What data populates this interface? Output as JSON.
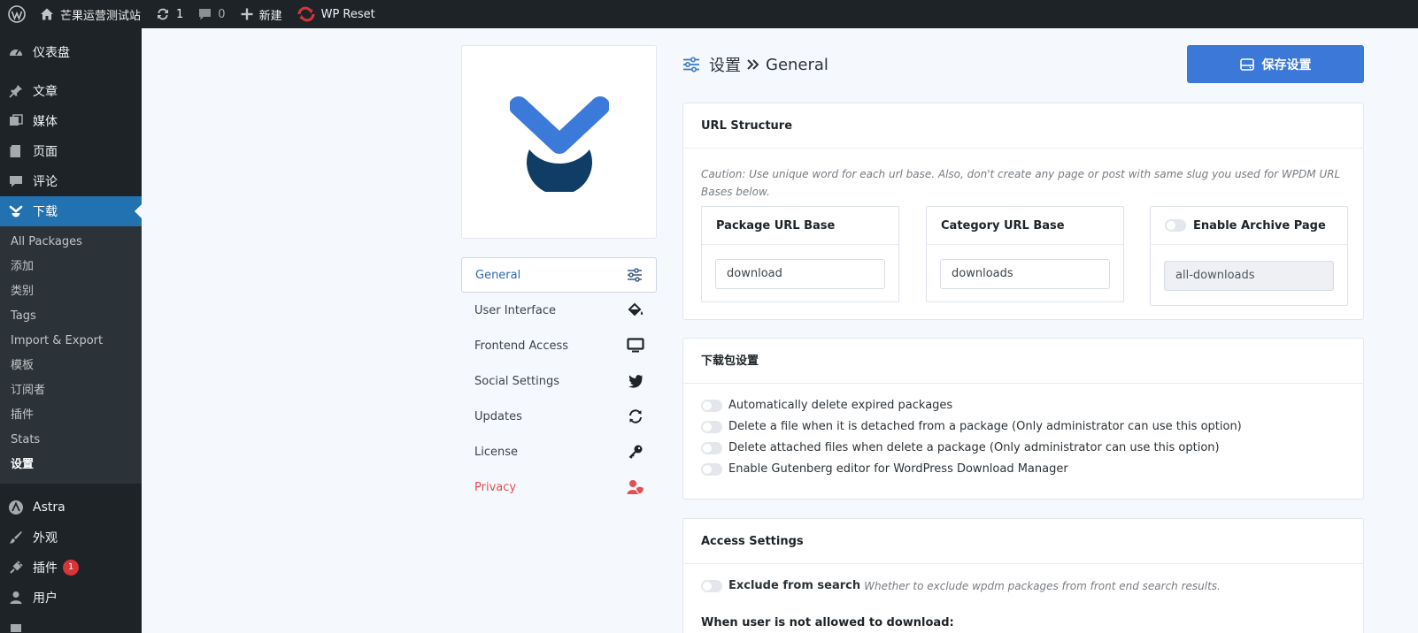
{
  "adminbar": {
    "site_name": "芒果运营测试站",
    "updates_count": "1",
    "comments_count": "0",
    "new_label": "新建",
    "plugin_label": "WP Reset"
  },
  "adminmenu": {
    "dashboard": "仪表盘",
    "posts": "文章",
    "media": "媒体",
    "pages": "页面",
    "comments": "评论",
    "downloads": "下载",
    "downloads_submenu": [
      "All Packages",
      "添加",
      "类别",
      "Tags",
      "Import & Export",
      "模板",
      "订阅者",
      "插件",
      "Stats",
      "设置"
    ],
    "astra": "Astra",
    "appearance": "外观",
    "plugins": "插件",
    "plugins_badge": "1",
    "users": "用户"
  },
  "settings_nav": [
    {
      "label": "General",
      "icon": "sliders-icon"
    },
    {
      "label": "User Interface",
      "icon": "paint-bucket-icon"
    },
    {
      "label": "Frontend Access",
      "icon": "monitor-icon"
    },
    {
      "label": "Social Settings",
      "icon": "twitter-icon"
    },
    {
      "label": "Updates",
      "icon": "refresh-icon"
    },
    {
      "label": "License",
      "icon": "key-icon"
    },
    {
      "label": "Privacy",
      "icon": "user-shield-icon"
    }
  ],
  "header": {
    "title_prefix": "设置",
    "title_section": "General",
    "save_label": "保存设置"
  },
  "url_structure": {
    "title": "URL Structure",
    "caution": "Caution: Use unique word for each url base. Also, don't create any page or post with same slug you used for WPDM URL Bases below.",
    "package_base_label": "Package URL Base",
    "package_base_value": "download",
    "category_base_label": "Category URL Base",
    "category_base_value": "downloads",
    "archive_label": "Enable Archive Page",
    "archive_value": "all-downloads"
  },
  "package_settings": {
    "title": "下载包设置",
    "options": [
      "Automatically delete expired packages",
      "Delete a file when it is detached from a package (Only administrator can use this option)",
      "Delete attached files when delete a package (Only administrator can use this option)",
      "Enable Gutenberg editor for WordPress Download Manager"
    ]
  },
  "access_settings": {
    "title": "Access Settings",
    "exclude_label": "Exclude from search",
    "exclude_hint": "Whether to exclude wpdm packages from front end search results.",
    "not_allowed_label": "When user is not allowed to download:"
  },
  "colors": {
    "primary": "#3b78d8",
    "admin_dark": "#1d2327",
    "menu_current": "#2271b1",
    "privacy_red": "#e25050"
  }
}
